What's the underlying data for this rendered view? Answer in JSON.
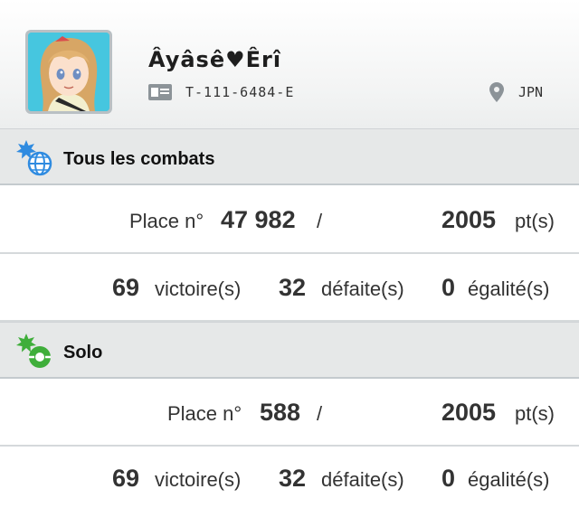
{
  "profile": {
    "name": "Âyâsê♥Êrî",
    "trainer_id": "T-111-6484-E",
    "country": "JPN"
  },
  "sections": [
    {
      "title": "Tous les combats",
      "icon": "globe-icon",
      "place_label": "Place n°",
      "rank": "47 982",
      "separator": "/",
      "points": "2005",
      "points_unit": "pt(s)",
      "wins": "69",
      "wins_label": "victoire(s)",
      "losses": "32",
      "losses_label": "défaite(s)",
      "draws": "0",
      "draws_label": "égalité(s)"
    },
    {
      "title": "Solo",
      "icon": "single-battle-icon",
      "place_label": "Place n°",
      "rank": "588",
      "separator": "/",
      "points": "2005",
      "points_unit": "pt(s)",
      "wins": "69",
      "wins_label": "victoire(s)",
      "losses": "32",
      "losses_label": "défaite(s)",
      "draws": "0",
      "draws_label": "égalité(s)"
    }
  ],
  "colors": {
    "header_bg": "#e6e8e8",
    "globe_blue": "#2f8be0",
    "solo_green": "#3fae3a"
  }
}
